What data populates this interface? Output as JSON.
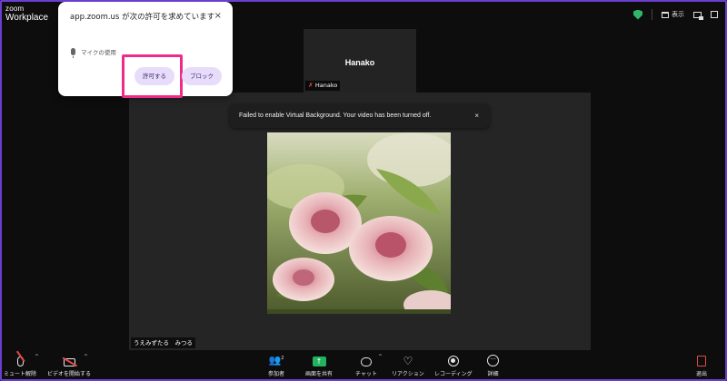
{
  "header": {
    "logo_line1": "zoom",
    "logo_line2": "Workplace",
    "view_label": "表示"
  },
  "permission_prompt": {
    "title": "app.zoom.us が次の許可を求めています",
    "permission": "マイクの使用",
    "allow_label": "許可する",
    "block_label": "ブロック",
    "close_glyph": "×"
  },
  "participant": {
    "name": "Hanako",
    "label": "Hanako"
  },
  "toast": {
    "message": "Failed to enable Virtual Background. Your video has been turned off.",
    "close_glyph": "×"
  },
  "main_video": {
    "label": "うえみずたる　みつる"
  },
  "toolbar": {
    "mute_label": "ミュート解除",
    "video_label": "ビデオを開始する",
    "participants_label": "参加者",
    "participants_count": "2",
    "share_label": "画面を共有",
    "chat_label": "チャット",
    "reactions_label": "リアクション",
    "record_label": "レコーディング",
    "more_label": "詳細",
    "leave_label": "退出"
  },
  "colors": {
    "accent_highlight": "#ee2a8a",
    "button_bg": "#e8dcfb",
    "share_green": "#22b35e",
    "security_green": "#2fb66b",
    "mute_red": "#e54848"
  }
}
